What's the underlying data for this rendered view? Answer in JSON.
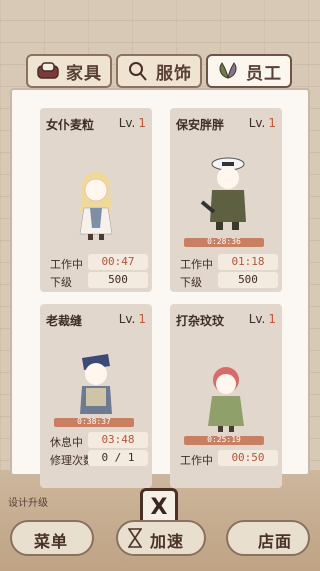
{
  "tabs": [
    {
      "label": "家具",
      "icon": "sofa-icon"
    },
    {
      "label": "服饰",
      "icon": "clothes-icon"
    },
    {
      "label": "员工",
      "icon": "leaf-wings-icon"
    }
  ],
  "staff": [
    {
      "name": "女仆麦粒",
      "lv_prefix": "Lv.",
      "level": "1",
      "rows": [
        {
          "label": "工作中",
          "value": "00:47"
        },
        {
          "label": "下级",
          "value": "500"
        }
      ],
      "bar": ""
    },
    {
      "name": "保安胖胖",
      "lv_prefix": "Lv.",
      "level": "1",
      "rows": [
        {
          "label": "工作中",
          "value": "01:18"
        },
        {
          "label": "下级",
          "value": "500"
        }
      ],
      "bar": "0:28:36"
    },
    {
      "name": "老裁缝",
      "lv_prefix": "Lv.",
      "level": "1",
      "rows": [
        {
          "label": "休息中",
          "value": "03:48"
        },
        {
          "label": "修理次数",
          "value": "0 / 1"
        }
      ],
      "bar": "0:38:37"
    },
    {
      "name": "打杂玟玟",
      "lv_prefix": "Lv.",
      "level": "1",
      "rows": [
        {
          "label": "工作中",
          "value": "00:50"
        }
      ],
      "bar": "0:25:19"
    }
  ],
  "bottom": {
    "menu_label": "菜单",
    "speed_label": "加速",
    "shop_label": "店面",
    "close_label": "X",
    "hint": "设计升级"
  },
  "colors": {
    "accent": "#c4593a",
    "bar": "#c98062",
    "panel": "#fbf8f3",
    "card": "#e2d7cc"
  }
}
